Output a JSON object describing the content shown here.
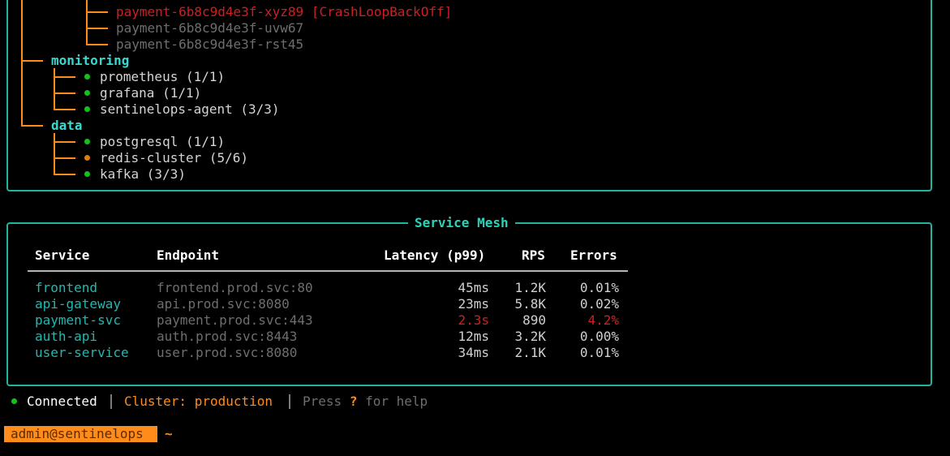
{
  "tree": {
    "pods": [
      {
        "name": "payment-6b8c9d4e3f-xyz89",
        "status": "[CrashLoopBackOff]"
      },
      {
        "name": "payment-6b8c9d4e3f-uvw67"
      },
      {
        "name": "payment-6b8c9d4e3f-rst45"
      }
    ],
    "namespaces": [
      {
        "name": "monitoring",
        "items": [
          {
            "label": "prometheus (1/1)",
            "health": "green"
          },
          {
            "label": "grafana (1/1)",
            "health": "green"
          },
          {
            "label": "sentinelops-agent (3/3)",
            "health": "green"
          }
        ]
      },
      {
        "name": "data",
        "items": [
          {
            "label": "postgresql (1/1)",
            "health": "green"
          },
          {
            "label": "redis-cluster (5/6)",
            "health": "orange"
          },
          {
            "label": "kafka (3/3)",
            "health": "green"
          }
        ]
      }
    ]
  },
  "mesh": {
    "title": "Service Mesh",
    "headers": {
      "service": "Service",
      "endpoint": "Endpoint",
      "latency": "Latency (p99)",
      "rps": "RPS",
      "errors": "Errors"
    },
    "rows": [
      {
        "service": "frontend",
        "endpoint": "frontend.prod.svc:80",
        "latency": "45ms",
        "rps": "1.2K",
        "errors": "0.01%"
      },
      {
        "service": "api-gateway",
        "endpoint": "api.prod.svc:8080",
        "latency": "23ms",
        "rps": "5.8K",
        "errors": "0.02%"
      },
      {
        "service": "payment-svc",
        "endpoint": "payment.prod.svc:443",
        "latency": "2.3s",
        "rps": "890",
        "errors": "4.2%"
      },
      {
        "service": "auth-api",
        "endpoint": "auth.prod.svc:8443",
        "latency": "12ms",
        "rps": "3.2K",
        "errors": "0.00%"
      },
      {
        "service": "user-service",
        "endpoint": "user.prod.svc:8080",
        "latency": "34ms",
        "rps": "2.1K",
        "errors": "0.01%"
      }
    ]
  },
  "status_bar": {
    "connection": "Connected",
    "cluster_label": "Cluster:",
    "cluster_value": "production",
    "help_prefix": "Press",
    "help_key": "?",
    "help_suffix": "for help"
  },
  "prompt": {
    "user_host": "admin@sentinelops",
    "path": "~"
  },
  "colors": {
    "accent": "#1fb5a0",
    "tree": "#ff8c1a",
    "error": "#cc2020",
    "ok": "#13c313",
    "warn": "#e07b10"
  }
}
